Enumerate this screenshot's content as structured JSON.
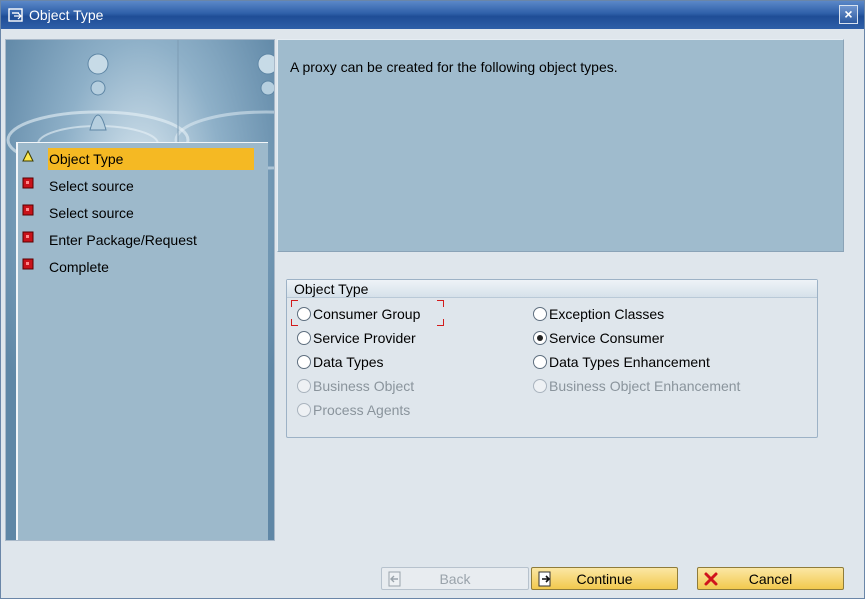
{
  "window": {
    "title": "Object Type",
    "close_glyph": "×"
  },
  "wizard_steps": [
    {
      "label": "Object Type",
      "status": "warning-triangle-icon",
      "active": true
    },
    {
      "label": "Select source",
      "status": "red-square-icon",
      "active": false
    },
    {
      "label": "Select source",
      "status": "red-square-icon",
      "active": false
    },
    {
      "label": "Enter Package/Request",
      "status": "red-square-icon",
      "active": false
    },
    {
      "label": "Complete",
      "status": "red-square-icon",
      "active": false
    }
  ],
  "info": {
    "text": "A proxy can be created for the following object types."
  },
  "object_type_group": {
    "title": "Object Type",
    "options": [
      {
        "label": "Consumer Group",
        "selected": false,
        "enabled": true
      },
      {
        "label": "Service Provider",
        "selected": false,
        "enabled": true
      },
      {
        "label": "Data Types",
        "selected": false,
        "enabled": true
      },
      {
        "label": "Business Object",
        "selected": false,
        "enabled": false
      },
      {
        "label": "Process Agents",
        "selected": false,
        "enabled": false
      },
      {
        "label": "Exception Classes",
        "selected": false,
        "enabled": true
      },
      {
        "label": "Service Consumer",
        "selected": true,
        "enabled": true
      },
      {
        "label": "Data Types Enhancement",
        "selected": false,
        "enabled": true
      },
      {
        "label": "Business Object Enhancement",
        "selected": false,
        "enabled": false
      }
    ]
  },
  "buttons": {
    "back": {
      "label": "Back",
      "enabled": false
    },
    "continue": {
      "label": "Continue",
      "enabled": true
    },
    "cancel": {
      "label": "Cancel",
      "enabled": true
    }
  },
  "colors": {
    "active_step": "#f5b923",
    "title_bar": "#2e5fa8",
    "panel": "#9fbbcd"
  }
}
